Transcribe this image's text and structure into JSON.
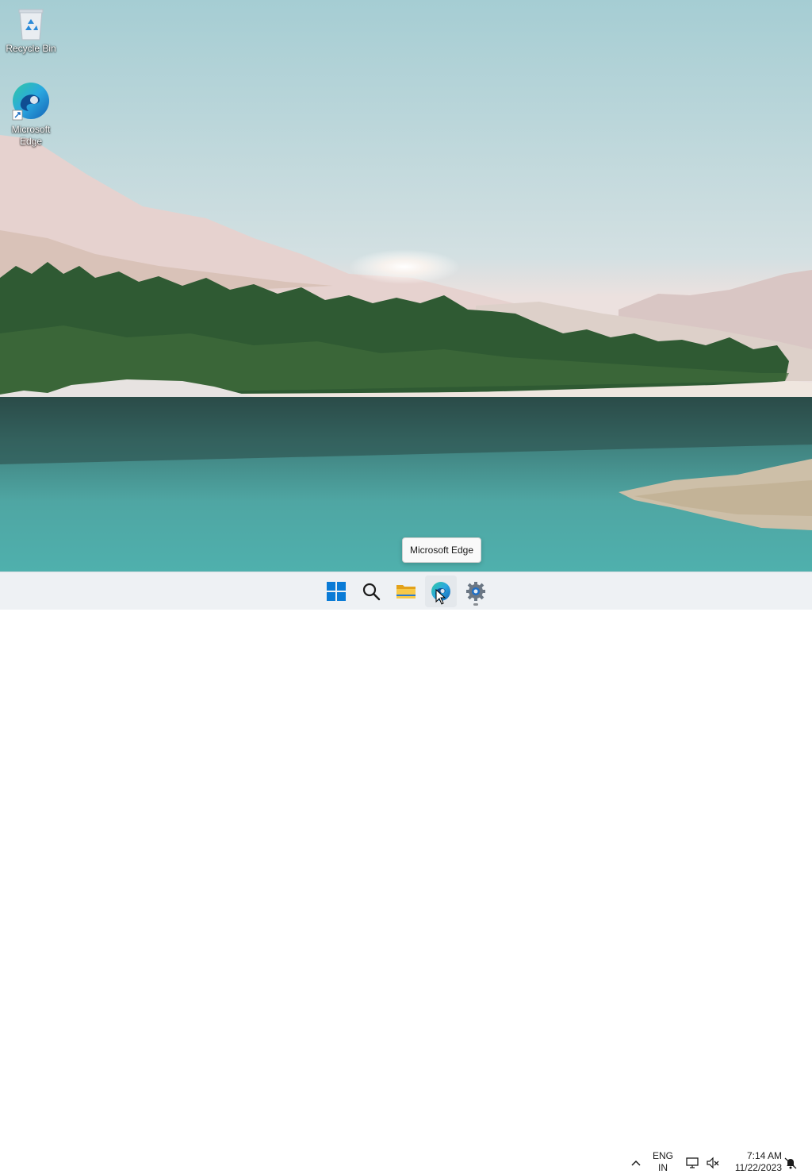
{
  "desktop": {
    "icons": [
      {
        "label": "Recycle Bin",
        "icon": "recycle-bin-icon"
      },
      {
        "label": "Microsoft Edge",
        "icon": "edge-icon"
      }
    ],
    "tooltip": "Microsoft Edge"
  },
  "taskbar": {
    "apps": [
      {
        "name": "Start",
        "icon": "windows-start-icon"
      },
      {
        "name": "Search",
        "icon": "search-icon"
      },
      {
        "name": "File Explorer",
        "icon": "folder-icon"
      },
      {
        "name": "Microsoft Edge",
        "icon": "edge-icon",
        "active": true
      },
      {
        "name": "Settings",
        "icon": "gear-icon",
        "running": true
      }
    ],
    "tray": {
      "lang_line1": "ENG",
      "lang_line2": "IN",
      "time": "7:14 AM",
      "date": "11/22/2023"
    }
  },
  "colors": {
    "start_blue": "#0078d4",
    "taskbar_bg": "#eef1f4",
    "folder_yellow": "#f2b52a"
  }
}
